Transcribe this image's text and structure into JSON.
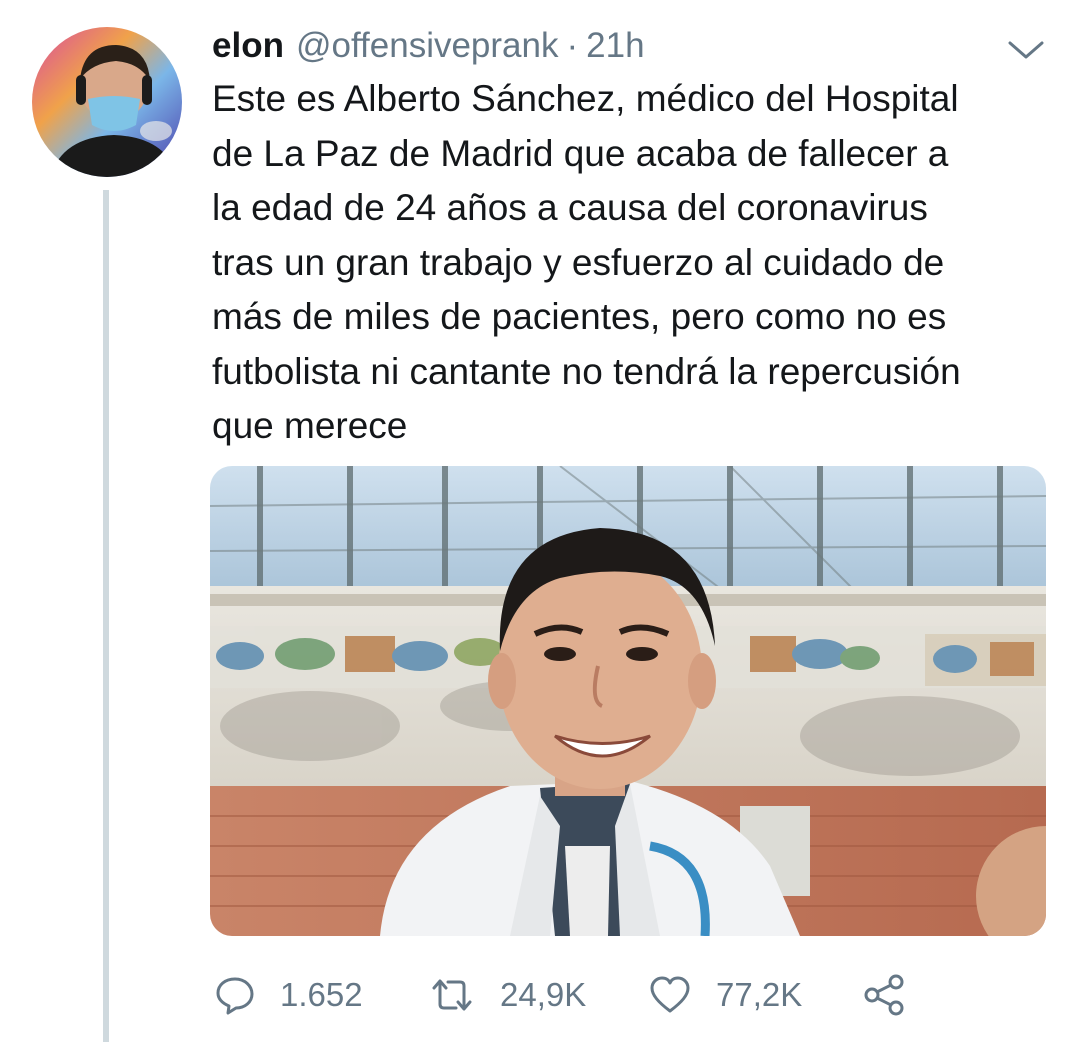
{
  "tweet": {
    "display_name": "elon",
    "handle": "@offensiveprank",
    "separator": "·",
    "time": "21h",
    "text": "Este es Alberto Sánchez, médico del Hospital\nde La Paz de Madrid que acaba de fallecer a\nla edad de 24 años a causa del coronavirus\ntras un gran trabajo y esfuerzo al cuidado de\nmás de miles de pacientes, pero como no es\nfutbolista ni cantante no tendrá la repercusión\nque merece"
  },
  "actions": {
    "reply_count": "1.652",
    "retweet_count": "24,9K",
    "like_count": "77,2K"
  },
  "icons": {
    "avatar": "profile-avatar",
    "caret": "chevron-down-icon",
    "reply": "reply-icon",
    "retweet": "retweet-icon",
    "like": "heart-icon",
    "share": "share-icon"
  },
  "colors": {
    "text": "#14171a",
    "secondary": "#657786",
    "thread_line": "#cfd9de"
  }
}
